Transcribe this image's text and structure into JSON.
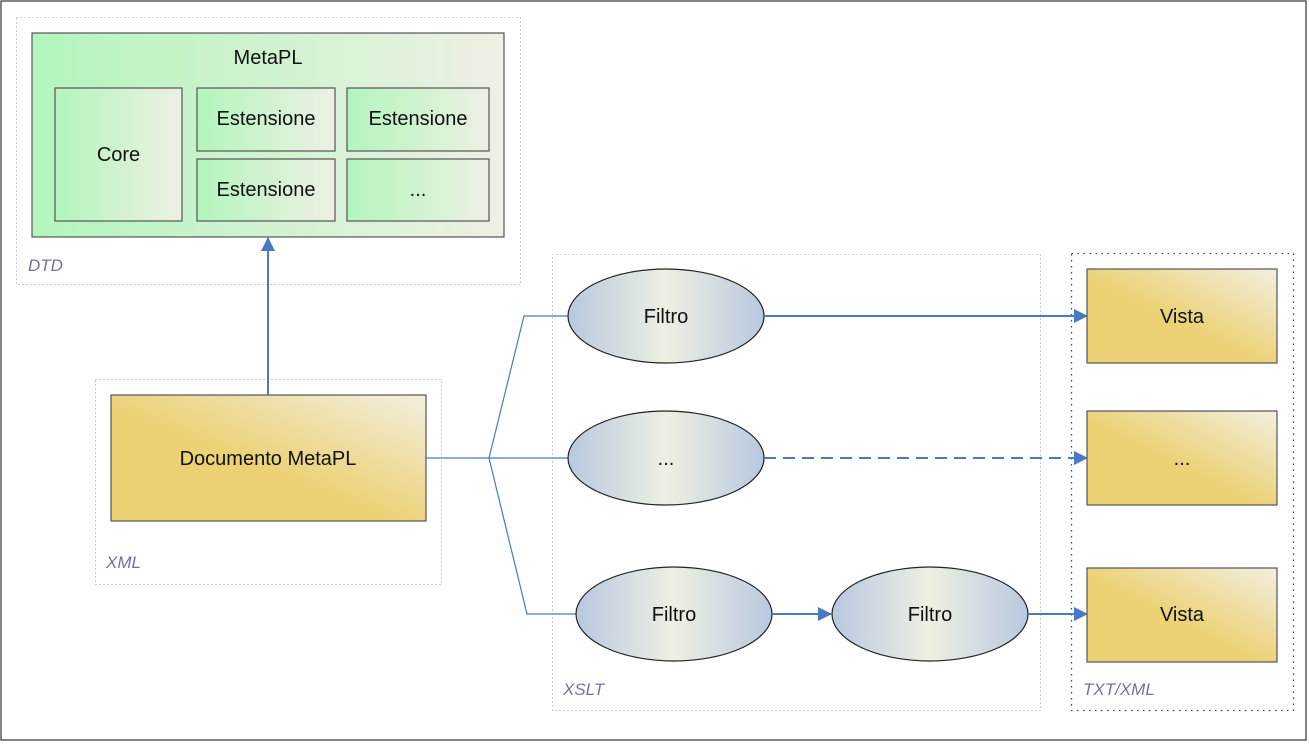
{
  "groups": {
    "dtd": "DTD",
    "xml": "XML",
    "xslt": "XSLT",
    "output": "TXT/XML"
  },
  "metapl": {
    "title": "MetaPL",
    "core": "Core",
    "extensions": [
      "Estensione",
      "Estensione",
      "Estensione",
      "..."
    ]
  },
  "document": "Documento MetaPL",
  "filters": {
    "top": "Filtro",
    "middle": "...",
    "bottom_first": "Filtro",
    "bottom_second": "Filtro"
  },
  "views": [
    "Vista",
    "...",
    "Vista"
  ],
  "colors": {
    "arrow": "#4a78c4",
    "green_start": "#b3f5bd",
    "green_end": "#eef0e4",
    "gold": "#ecd175",
    "ellipse_edge": "#b8c8e0",
    "ellipse_center": "#eef0e2",
    "group_label": "#7471a6"
  }
}
